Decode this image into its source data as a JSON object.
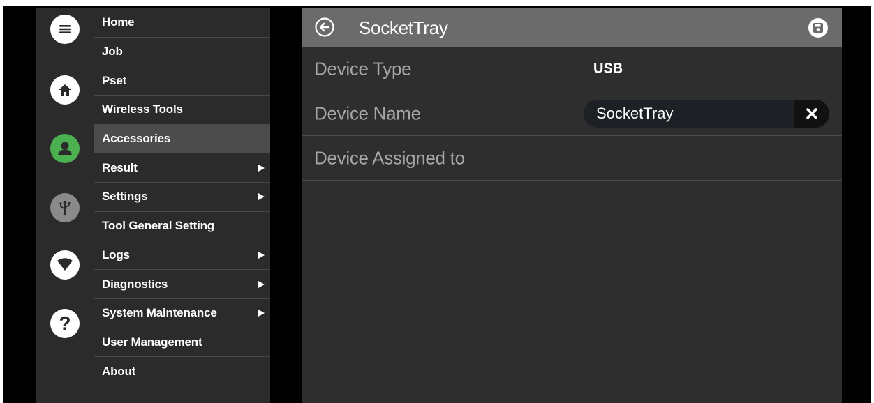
{
  "sidebar": {
    "icons": [
      {
        "name": "hamburger-menu-icon",
        "color": "#ffffff"
      },
      {
        "name": "home-icon",
        "color": "#ffffff"
      },
      {
        "name": "user-icon",
        "color": "#4caf50"
      },
      {
        "name": "usb-icon",
        "color": "#8a8a8a"
      },
      {
        "name": "wifi-icon",
        "color": "#ffffff"
      },
      {
        "name": "help-icon",
        "color": "#ffffff"
      }
    ],
    "items": [
      {
        "label": "Home",
        "has_submenu": false
      },
      {
        "label": "Job",
        "has_submenu": false
      },
      {
        "label": "Pset",
        "has_submenu": false
      },
      {
        "label": "Wireless Tools",
        "has_submenu": false
      },
      {
        "label": "Accessories",
        "has_submenu": false,
        "active": true
      },
      {
        "label": "Result",
        "has_submenu": true
      },
      {
        "label": "Settings",
        "has_submenu": true
      },
      {
        "label": "Tool General Setting",
        "has_submenu": false
      },
      {
        "label": "Logs",
        "has_submenu": true
      },
      {
        "label": "Diagnostics",
        "has_submenu": true
      },
      {
        "label": "System Maintenance",
        "has_submenu": true
      },
      {
        "label": "User Management",
        "has_submenu": false
      },
      {
        "label": "About",
        "has_submenu": false
      }
    ]
  },
  "panel": {
    "title": "SocketTray",
    "rows": {
      "device_type": {
        "label": "Device Type",
        "value": "USB"
      },
      "device_name": {
        "label": "Device Name",
        "value": "SocketTray"
      },
      "device_assigned": {
        "label": "Device Assigned to",
        "value": ""
      }
    }
  },
  "colors": {
    "sidebar_bg": "#2b2b2b",
    "active_item_bg": "#4c4c4c",
    "header_bg": "#6b6b6b",
    "panel_bg": "#2e2e2e",
    "user_icon_green": "#4caf50"
  }
}
